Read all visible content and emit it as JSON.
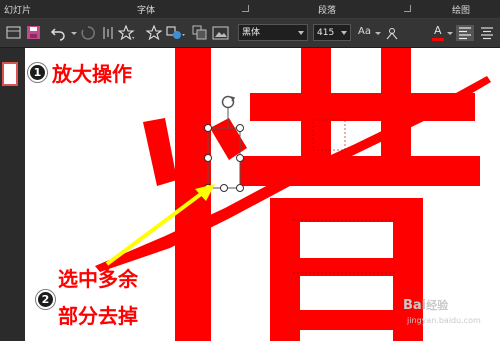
{
  "ribbon_groups": [
    {
      "label": "幻灯片"
    },
    {
      "label": "字体"
    },
    {
      "label": "段落"
    },
    {
      "label": "绘图"
    }
  ],
  "toolbar": {
    "font_name": "黑体",
    "font_size": "415",
    "case_button_label": "Aa",
    "font_color_label": "A",
    "font_color": "#ff0000",
    "icons": [
      "layout-icon",
      "save-icon",
      "undo-icon",
      "redo-icon",
      "columns-icon",
      "star-shape-icon",
      "star-outline-icon",
      "shapes-icon",
      "arrange-icon",
      "picture-icon",
      "align-left-icon",
      "align-center-icon"
    ]
  },
  "canvas": {
    "character": "惜",
    "character_color": "#ff0000"
  },
  "annotations": {
    "step1_number": "1",
    "step1_text": "放大操作",
    "step2_number": "2",
    "step2_text_line1": "选中多余",
    "step2_text_line2": "部分去掉",
    "arrow_color": "#ffff00"
  },
  "watermark": {
    "brand": "Bai",
    "brand_suffix": "经验",
    "url": "jingyan.baidu.com"
  }
}
